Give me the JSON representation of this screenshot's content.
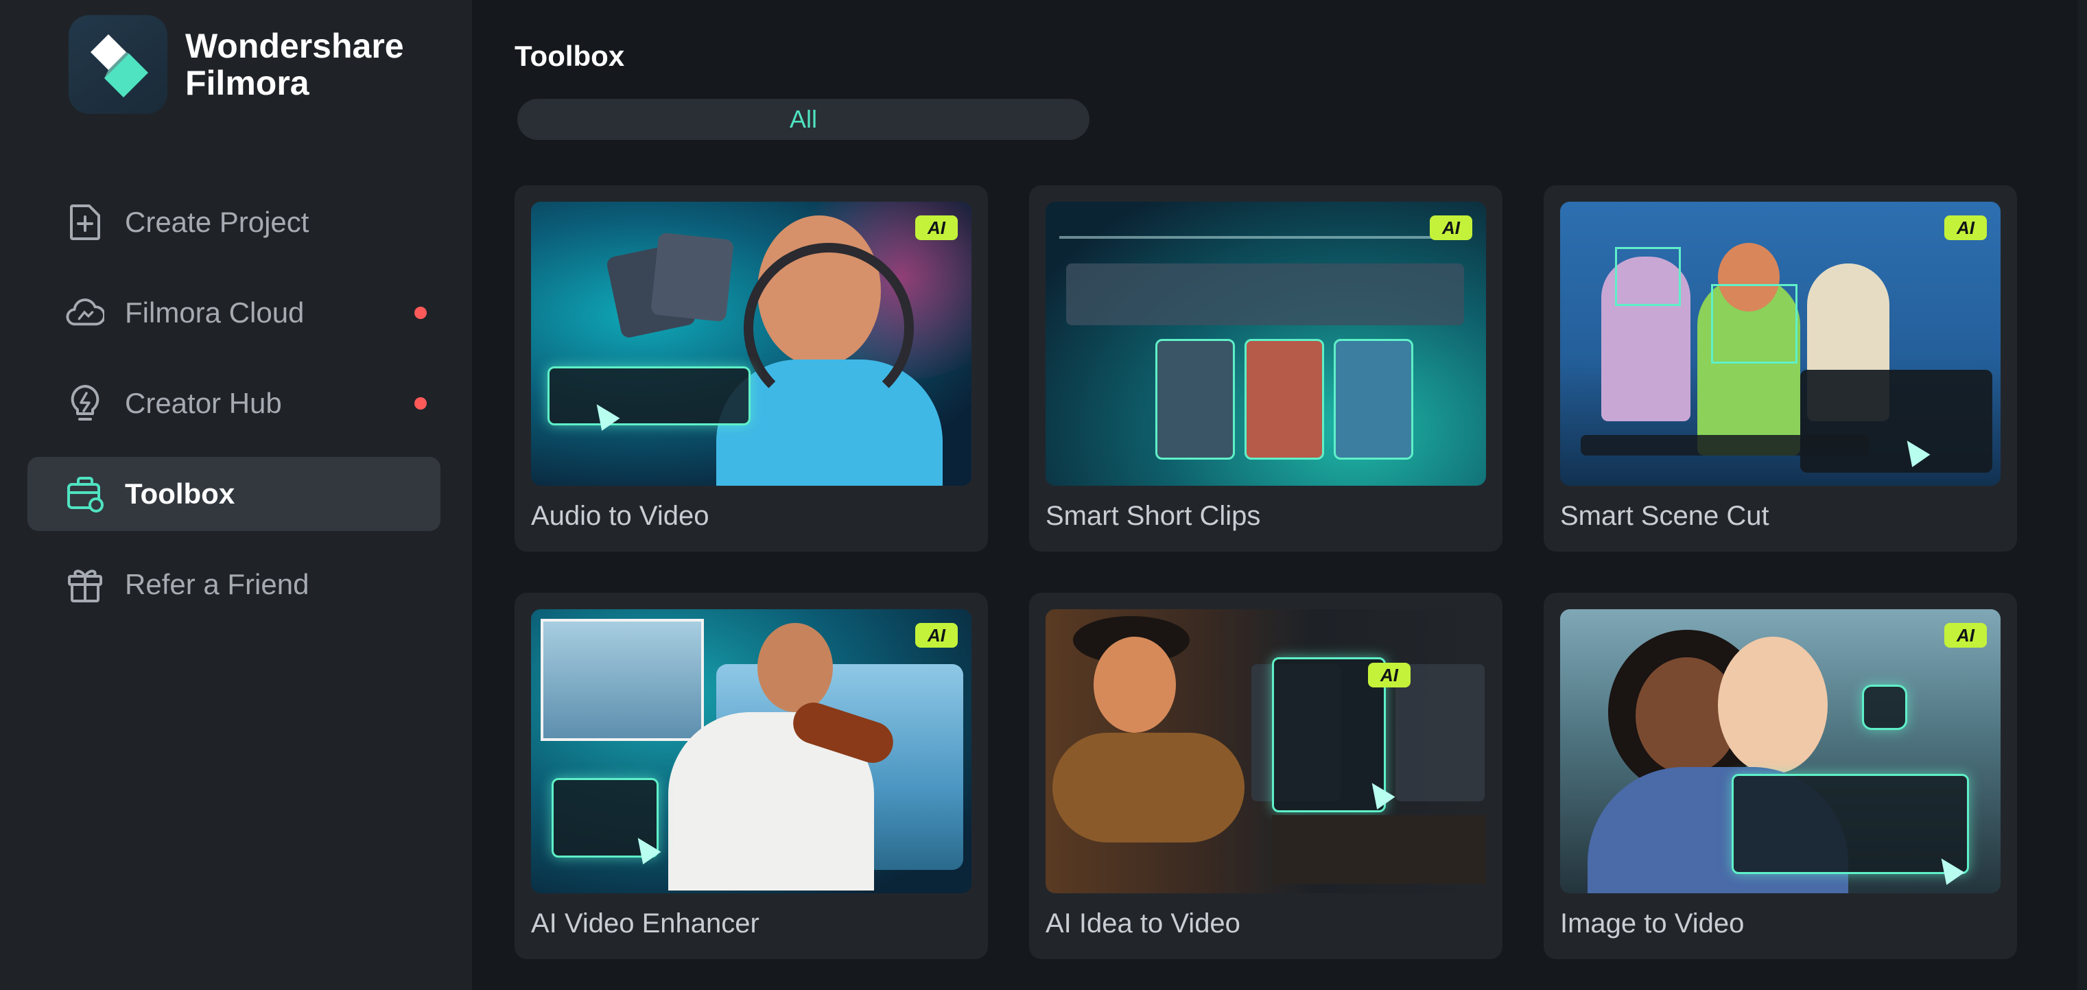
{
  "app": {
    "brand_line1": "Wondershare",
    "brand_line2": "Filmora"
  },
  "colors": {
    "accent": "#5ff0c8",
    "ai_badge": "#c4f23a",
    "notification_dot": "#ff5a5a",
    "active_tab_text": "#4fe3c1"
  },
  "sidebar": {
    "items": [
      {
        "label": "Create Project",
        "icon": "add-file-icon",
        "active": false,
        "dot": false
      },
      {
        "label": "Filmora Cloud",
        "icon": "cloud-icon",
        "active": false,
        "dot": true
      },
      {
        "label": "Creator Hub",
        "icon": "bulb-icon",
        "active": false,
        "dot": true
      },
      {
        "label": "Toolbox",
        "icon": "toolbox-icon",
        "active": true,
        "dot": false
      },
      {
        "label": "Refer a Friend",
        "icon": "gift-icon",
        "active": false,
        "dot": false
      }
    ]
  },
  "main": {
    "title": "Toolbox",
    "filter_tabs": [
      {
        "label": "All",
        "active": true
      }
    ],
    "cards": [
      {
        "label": "Audio to Video",
        "badge": "AI"
      },
      {
        "label": "Smart Short Clips",
        "badge": "AI"
      },
      {
        "label": "Smart Scene Cut",
        "badge": "AI"
      },
      {
        "label": "AI Video Enhancer",
        "badge": "AI"
      },
      {
        "label": "AI Idea to Video",
        "badge": "AI"
      },
      {
        "label": "Image to Video",
        "badge": "AI"
      }
    ]
  }
}
